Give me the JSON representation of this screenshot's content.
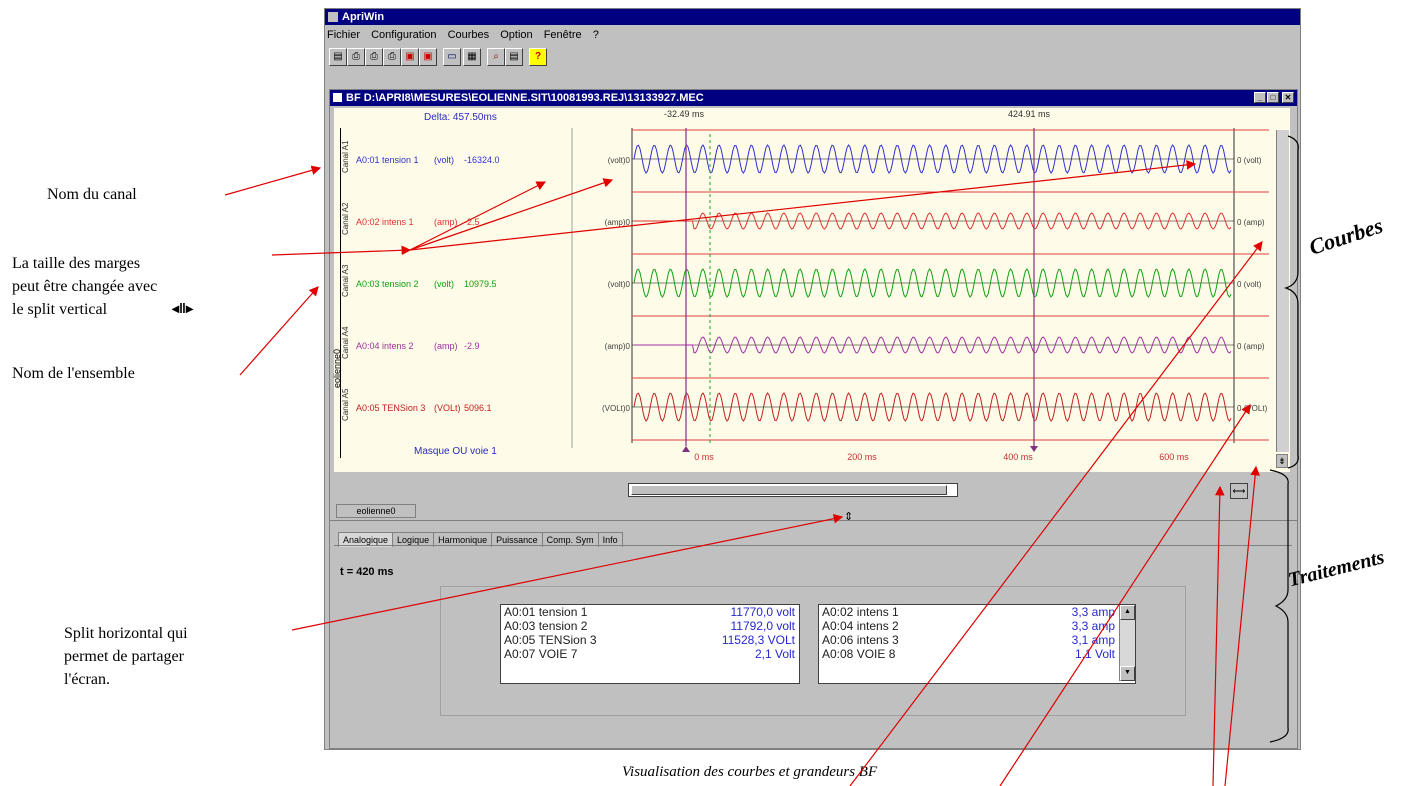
{
  "app": {
    "title": "ApriWin",
    "menu": [
      "Fichier",
      "Configuration",
      "Courbes",
      "Option",
      "Fenêtre",
      "?"
    ]
  },
  "child_window": {
    "title": "BF D:\\APRI8\\MESURES\\EOLIENNE.SIT\\10081993.REJ\\13133927.MEC"
  },
  "plot": {
    "delta": "Delta: 457.50ms",
    "cursor_left": "-32.49 ms",
    "cursor_right": "424.91 ms",
    "mask_label": "Masque OU voie 1",
    "group_vertical_label": "eolienne0",
    "channels": [
      {
        "name": "A0:01 tension 1",
        "unit": "(volt)",
        "value": "-16324.0",
        "canal": "Canal A1",
        "left_unit": "(volt)0",
        "right_unit": "0 (volt)",
        "color": "#3030d0"
      },
      {
        "name": "A0:02 intens 1",
        "unit": "(amp)",
        "value": "-2.5",
        "canal": "Canal A2",
        "left_unit": "(amp)0",
        "right_unit": "0 (amp)",
        "color": "#e03030"
      },
      {
        "name": "A0:03 tension 2",
        "unit": "(volt)",
        "value": "10979.5",
        "canal": "Canal A3",
        "left_unit": "(volt)0",
        "right_unit": "0 (volt)",
        "color": "#10a010"
      },
      {
        "name": "A0:04 intens 2",
        "unit": "(amp)",
        "value": "-2.9",
        "canal": "Canal A4",
        "left_unit": "(amp)0",
        "right_unit": "0 (amp)",
        "color": "#a030a0"
      },
      {
        "name": "A0:05 TENSion 3",
        "unit": "(VOLt)",
        "value": "5096.1",
        "canal": "Canal A5",
        "left_unit": "(VOLt)0",
        "right_unit": "0 (VOLt)",
        "color": "#c02020"
      }
    ],
    "x_ticks": [
      "0 ms",
      "200 ms",
      "400 ms",
      "600 ms"
    ]
  },
  "group_tab": "eolienne0",
  "tabs": [
    "Analogique",
    "Logique",
    "Harmonique",
    "Puissance",
    "Comp. Sym",
    "Info"
  ],
  "time_label": "t = 420   ms",
  "list_left": [
    {
      "name": "A0:01 tension 1",
      "value": "11770,0 volt"
    },
    {
      "name": "A0:03 tension 2",
      "value": "11792,0 volt"
    },
    {
      "name": "A0:05 TENSion 3",
      "value": "11528,3 VOLt"
    },
    {
      "name": "A0:07 VOIE 7",
      "value": "2,1 Volt"
    }
  ],
  "list_right": [
    {
      "name": "A0:02 intens 1",
      "value": "3,3 amp"
    },
    {
      "name": "A0:04 intens 2",
      "value": "3,3 amp"
    },
    {
      "name": "A0:06 intens 3",
      "value": "3,1 amp"
    },
    {
      "name": "A0:08 VOIE 8",
      "value": "1,1 Volt"
    }
  ],
  "annotations": {
    "nom_canal": "Nom du canal",
    "marges_1": "La taille des marges",
    "marges_2": "peut être changée avec",
    "marges_3": "le split vertical",
    "nom_ensemble": "Nom de l'ensemble",
    "split_h_1": "Split horizontal qui",
    "split_h_2": "permet de partager",
    "split_h_3": "l'écran.",
    "courbes": "Courbes",
    "traitements": "Traitements",
    "caption": "Visualisation des courbes et grandeurs BF"
  }
}
